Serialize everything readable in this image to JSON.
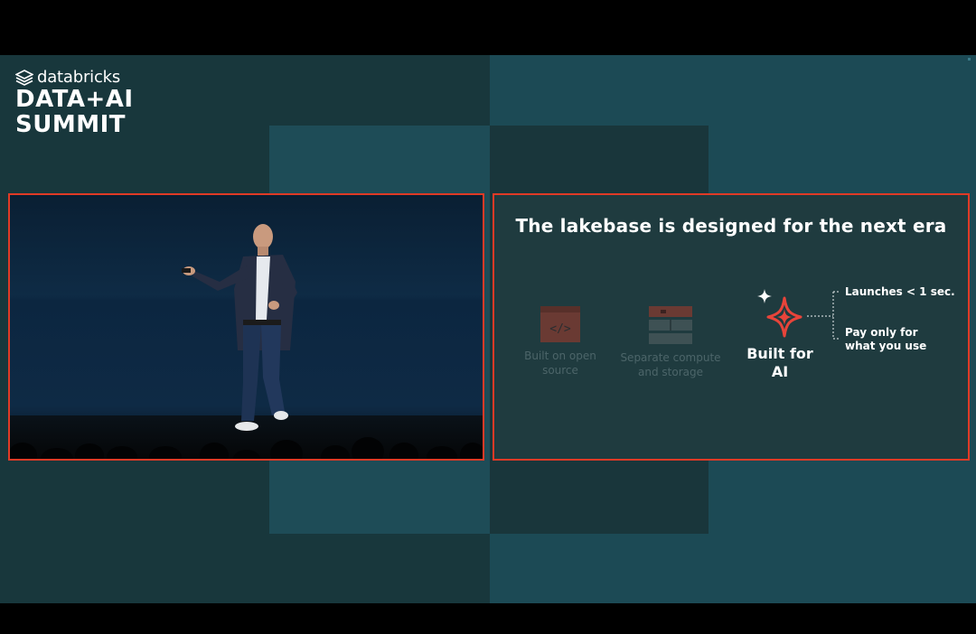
{
  "event": {
    "brand": "databricks",
    "title_line1": "DATA+AI",
    "title_line2": "SUMMIT"
  },
  "slide": {
    "title": "The lakebase is designed for the next era",
    "pillars": [
      {
        "icon": "code-window-icon",
        "label": "Built on open source",
        "state": "dimmed"
      },
      {
        "icon": "compute-storage-icon",
        "label": "Separate compute and storage",
        "state": "dimmed"
      },
      {
        "icon": "sparkle-icon",
        "label": "Built for AI",
        "state": "highlighted"
      }
    ],
    "bullets": [
      "Launches < 1 sec.",
      "Pay only for what you use"
    ]
  },
  "colors": {
    "frame_border": "#e03a26",
    "accent_red": "#e8443a",
    "bg_dark": "#18373c",
    "bg_teal": "#1c4a55"
  }
}
